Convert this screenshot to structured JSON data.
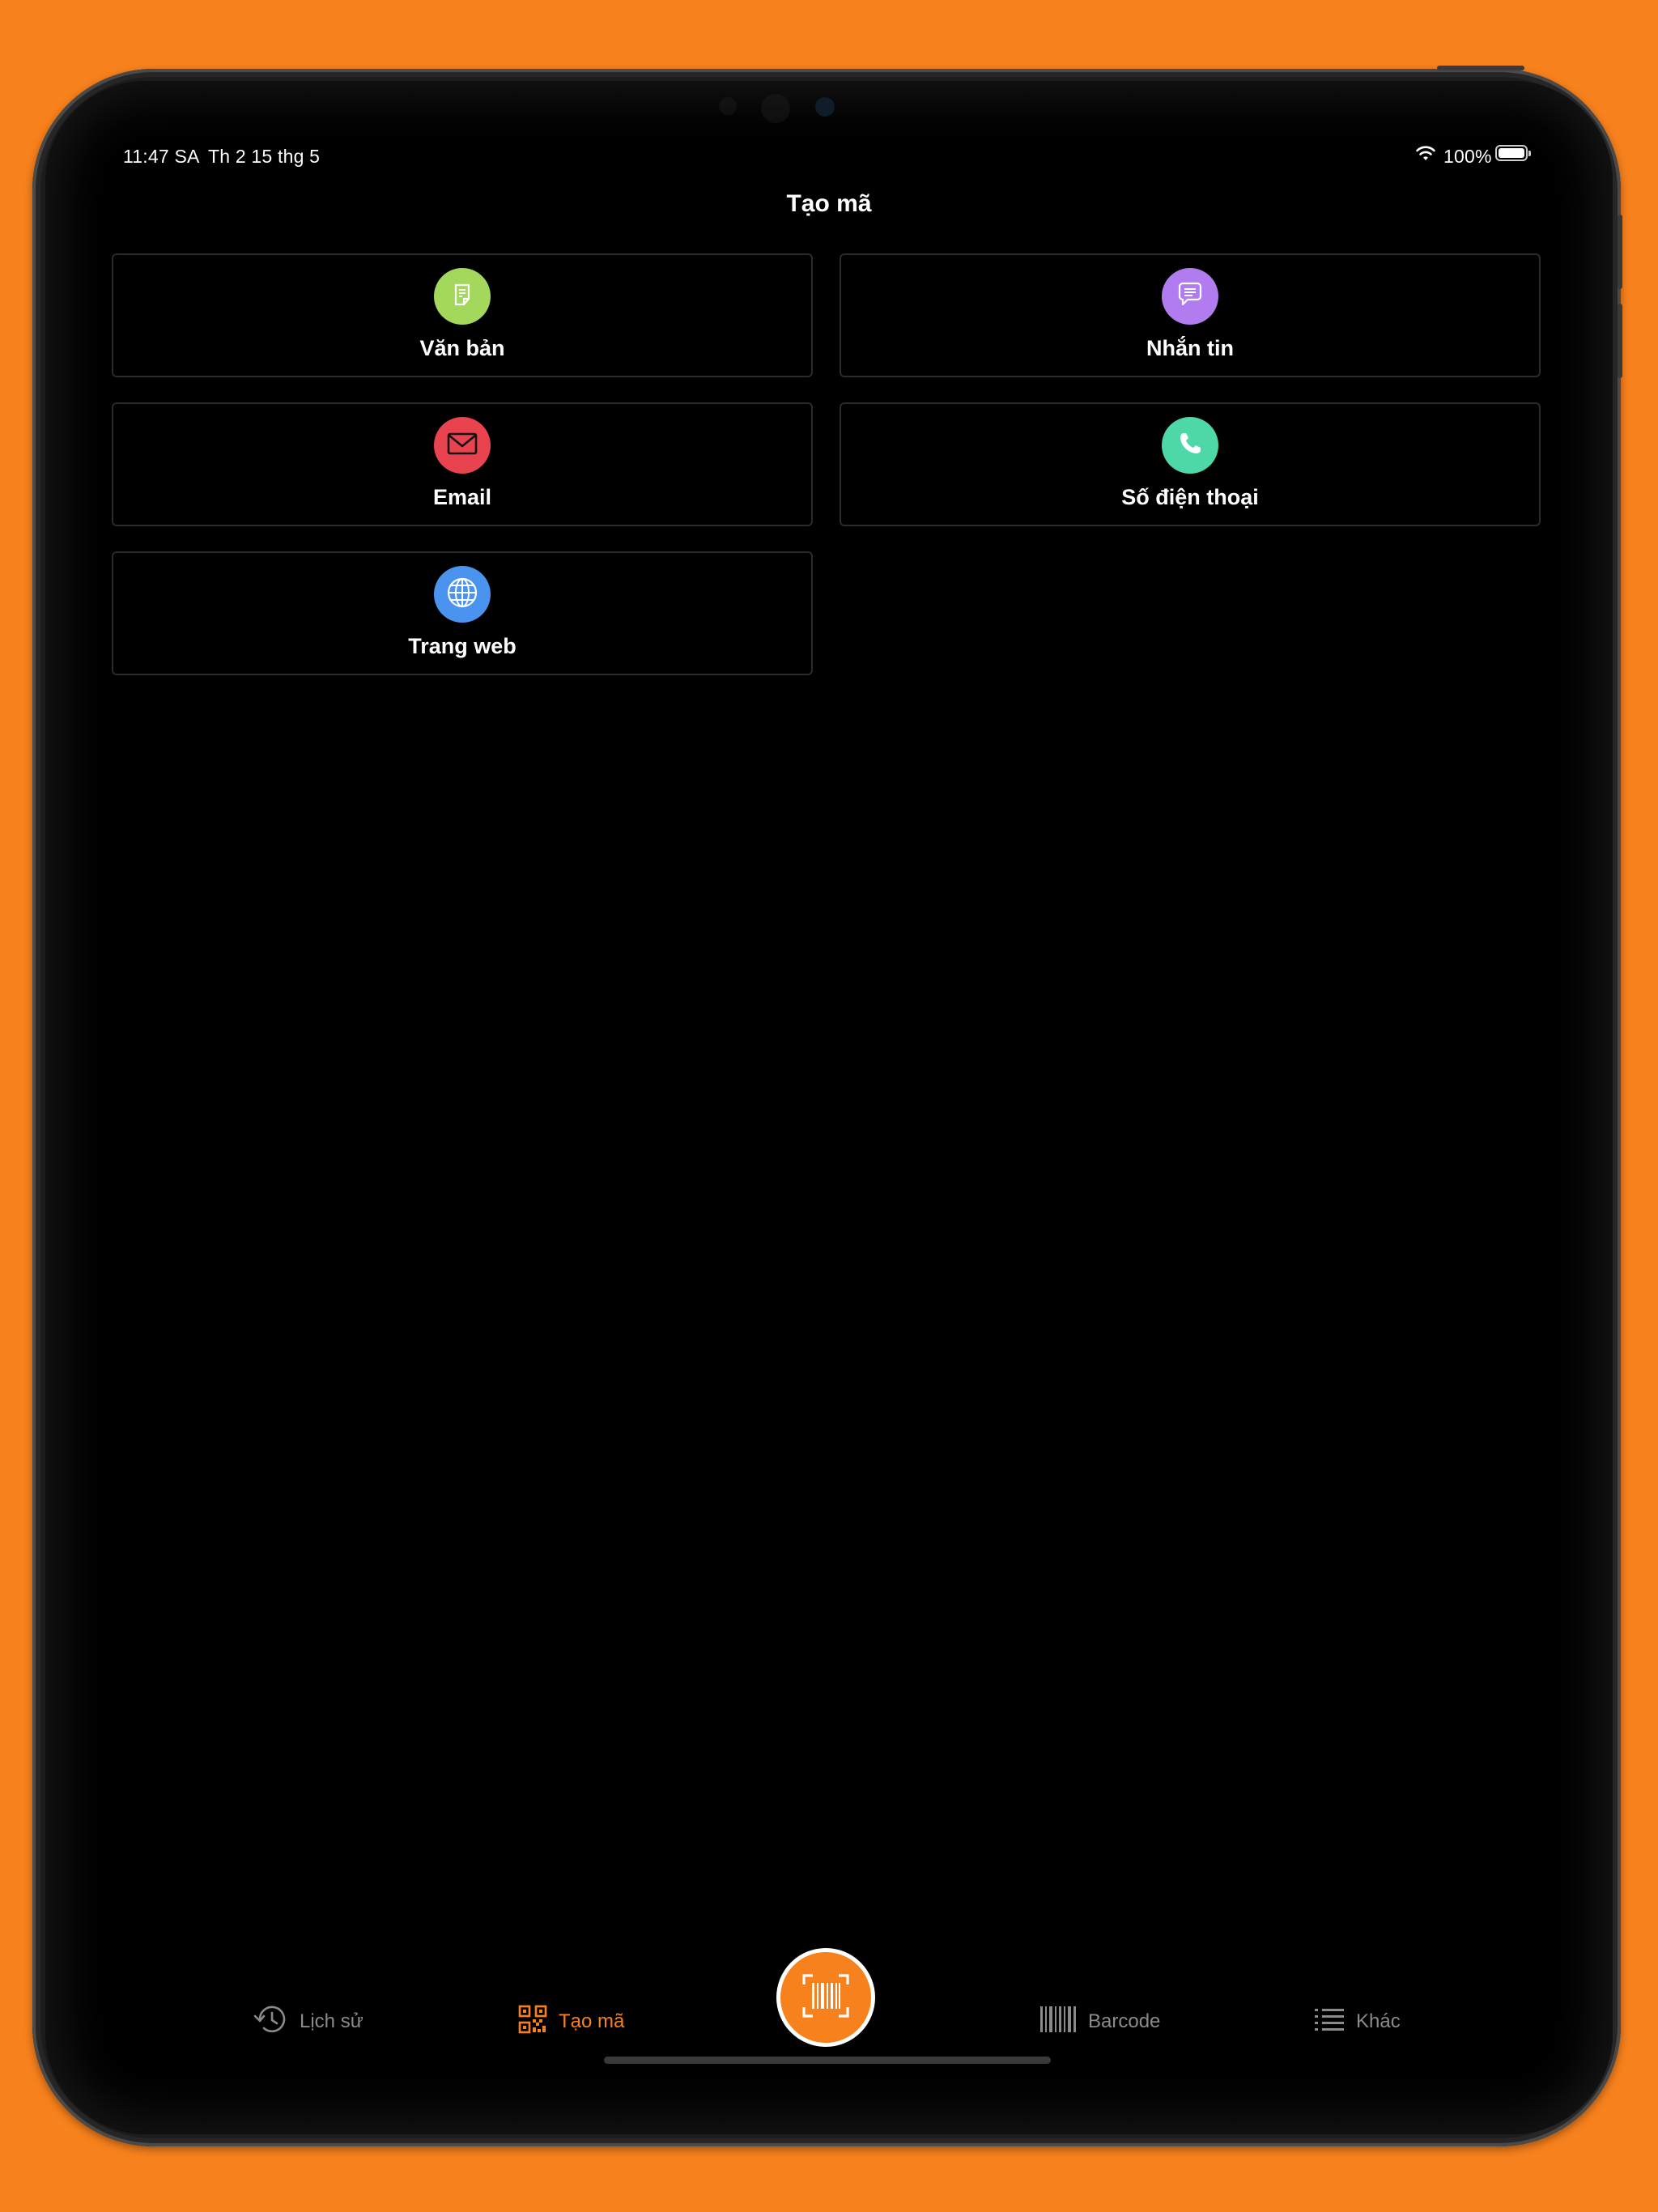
{
  "status_bar": {
    "time": "11:47 SA",
    "date": "Th 2 15 thg 5",
    "battery": "100%"
  },
  "header": {
    "title": "Tạo mã"
  },
  "options": [
    {
      "label": "Văn bản",
      "icon": "document-icon",
      "color": "#a3d85c"
    },
    {
      "label": "Nhắn tin",
      "icon": "message-icon",
      "color": "#b07cf0"
    },
    {
      "label": "Email",
      "icon": "mail-icon",
      "color": "#e8434f"
    },
    {
      "label": "Số điện thoại",
      "icon": "phone-icon",
      "color": "#4fd8a7"
    },
    {
      "label": "Trang web",
      "icon": "globe-icon",
      "color": "#4a94f0"
    }
  ],
  "tab_bar": {
    "items": [
      {
        "label": "Lịch sử",
        "icon": "history-icon"
      },
      {
        "label": "Tạo mã",
        "icon": "qr-code-icon",
        "active": true
      },
      {
        "label": "Barcode",
        "icon": "barcode-icon"
      },
      {
        "label": "Khác",
        "icon": "list-icon"
      }
    ],
    "scan_icon": "barcode-scan-icon"
  },
  "colors": {
    "accent": "#f7811c",
    "background": "#000000"
  }
}
